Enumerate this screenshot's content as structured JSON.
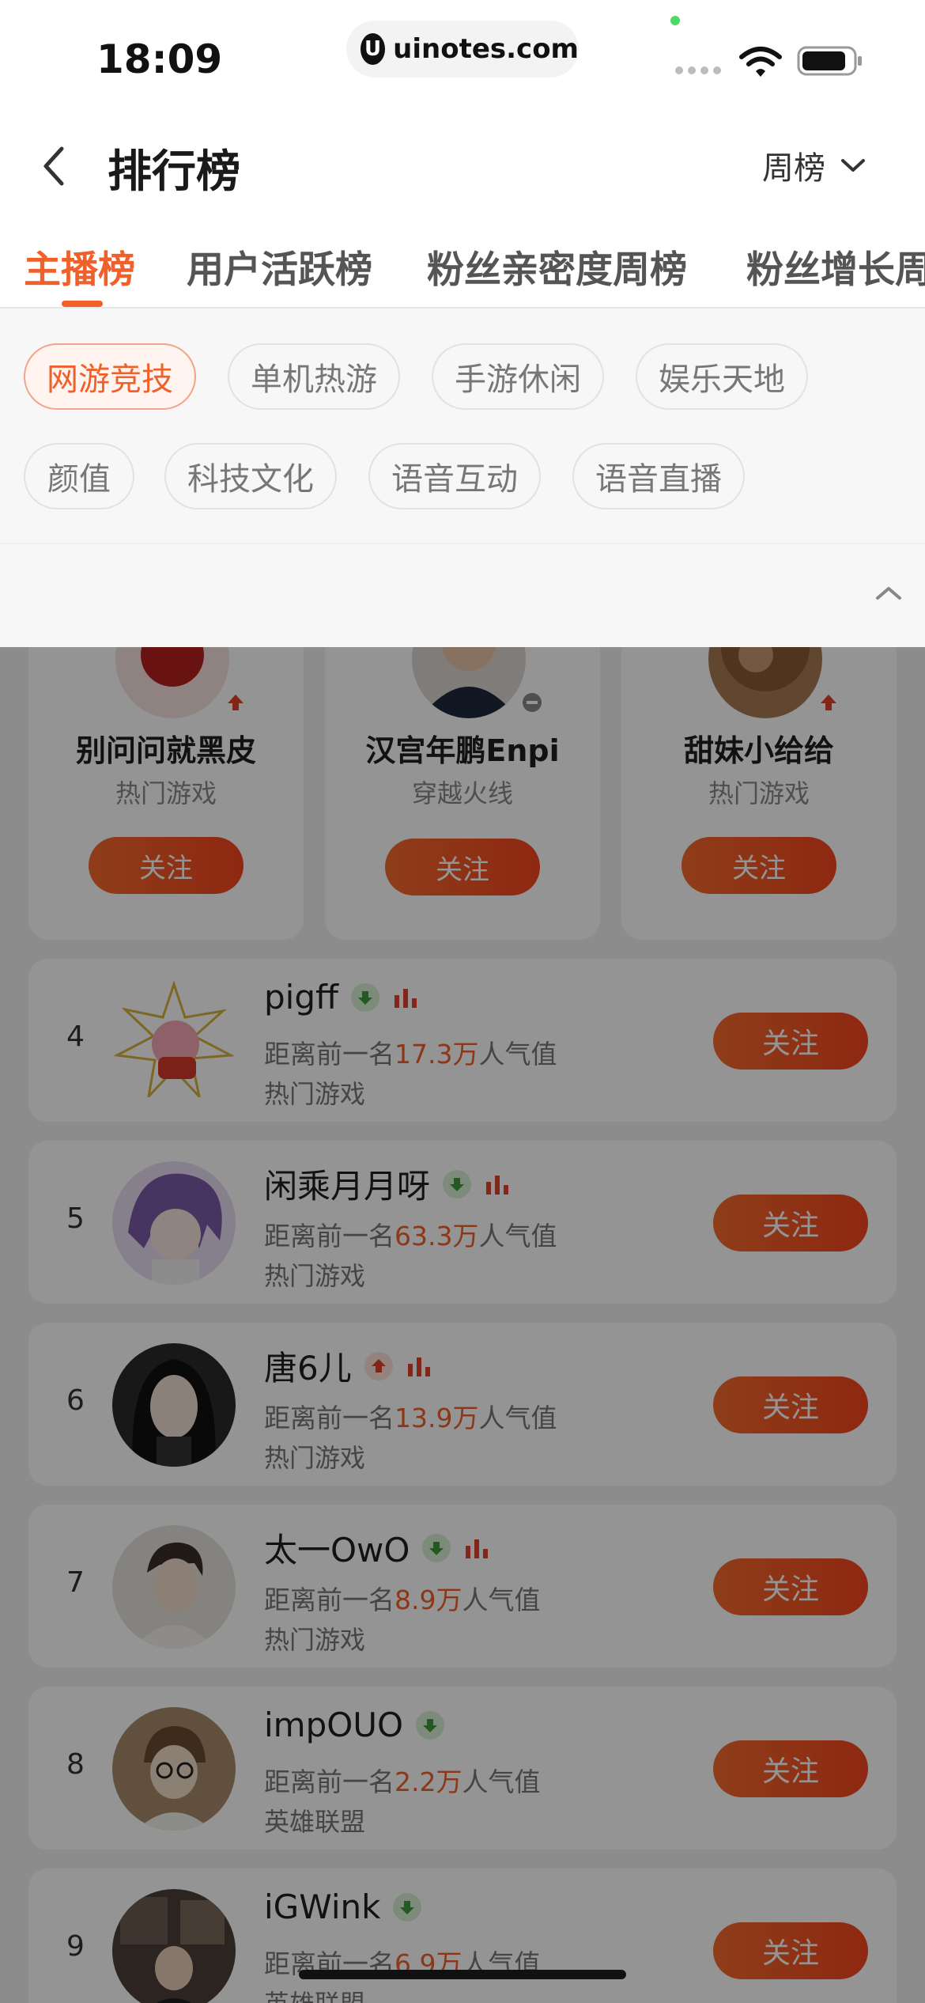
{
  "status_bar": {
    "time": "18:09",
    "url": "uinotes.com",
    "url_logo": "U"
  },
  "header": {
    "title": "排行榜",
    "period": "周榜"
  },
  "tabs": [
    {
      "label": "主播榜",
      "active": true
    },
    {
      "label": "用户活跃榜",
      "active": false
    },
    {
      "label": "粉丝亲密度周榜",
      "active": false
    },
    {
      "label": "粉丝增长周榜",
      "active": false
    }
  ],
  "categories": [
    {
      "label": "网游竞技",
      "active": true
    },
    {
      "label": "单机热游",
      "active": false
    },
    {
      "label": "手游休闲",
      "active": false
    },
    {
      "label": "娱乐天地",
      "active": false
    },
    {
      "label": "颜值",
      "active": false
    },
    {
      "label": "科技文化",
      "active": false
    },
    {
      "label": "语音互动",
      "active": false
    },
    {
      "label": "语音直播",
      "active": false
    }
  ],
  "top3": [
    {
      "name": "别问问就黑皮",
      "category": "热门游戏",
      "trend": "up",
      "follow": "关注"
    },
    {
      "name": "汉宫年鹏Enpi",
      "category": "穿越火线",
      "trend": "same",
      "follow": "关注"
    },
    {
      "name": "甜妹小给给",
      "category": "热门游戏",
      "trend": "up",
      "follow": "关注"
    }
  ],
  "ranking": [
    {
      "rank": "4",
      "name": "pigff",
      "trend": "down",
      "gap_prefix": "距离前一名",
      "gap_value": "17.3万",
      "gap_suffix": "人气值",
      "category": "热门游戏",
      "follow": "关注"
    },
    {
      "rank": "5",
      "name": "闲乘月月呀",
      "trend": "down",
      "gap_prefix": "距离前一名",
      "gap_value": "63.3万",
      "gap_suffix": "人气值",
      "category": "热门游戏",
      "follow": "关注"
    },
    {
      "rank": "6",
      "name": "唐6儿",
      "trend": "up",
      "gap_prefix": "距离前一名",
      "gap_value": "13.9万",
      "gap_suffix": "人气值",
      "category": "热门游戏",
      "follow": "关注"
    },
    {
      "rank": "7",
      "name": "太一OwO",
      "trend": "down",
      "gap_prefix": "距离前一名",
      "gap_value": "8.9万",
      "gap_suffix": "人气值",
      "category": "热门游戏",
      "follow": "关注"
    },
    {
      "rank": "8",
      "name": "impOUO",
      "trend": "down",
      "gap_prefix": "距离前一名",
      "gap_value": "2.2万",
      "gap_suffix": "人气值",
      "category": "英雄联盟",
      "follow": "关注"
    },
    {
      "rank": "9",
      "name": "iGWink",
      "trend": "down",
      "gap_prefix": "距离前一名",
      "gap_value": "6.9万",
      "gap_suffix": "人气值",
      "category": "英雄联盟",
      "follow": "关注"
    }
  ],
  "colors": {
    "accent": "#f0602a",
    "down_green": "#3f9b3a",
    "up_red": "#e0432c"
  },
  "icons": {
    "back": "chevron-left-icon",
    "period": "chevron-down-icon",
    "collapse": "chevron-up-icon",
    "trend_up": "arrow-up-icon",
    "trend_down": "arrow-down-icon",
    "stats": "bar-chart-icon"
  }
}
